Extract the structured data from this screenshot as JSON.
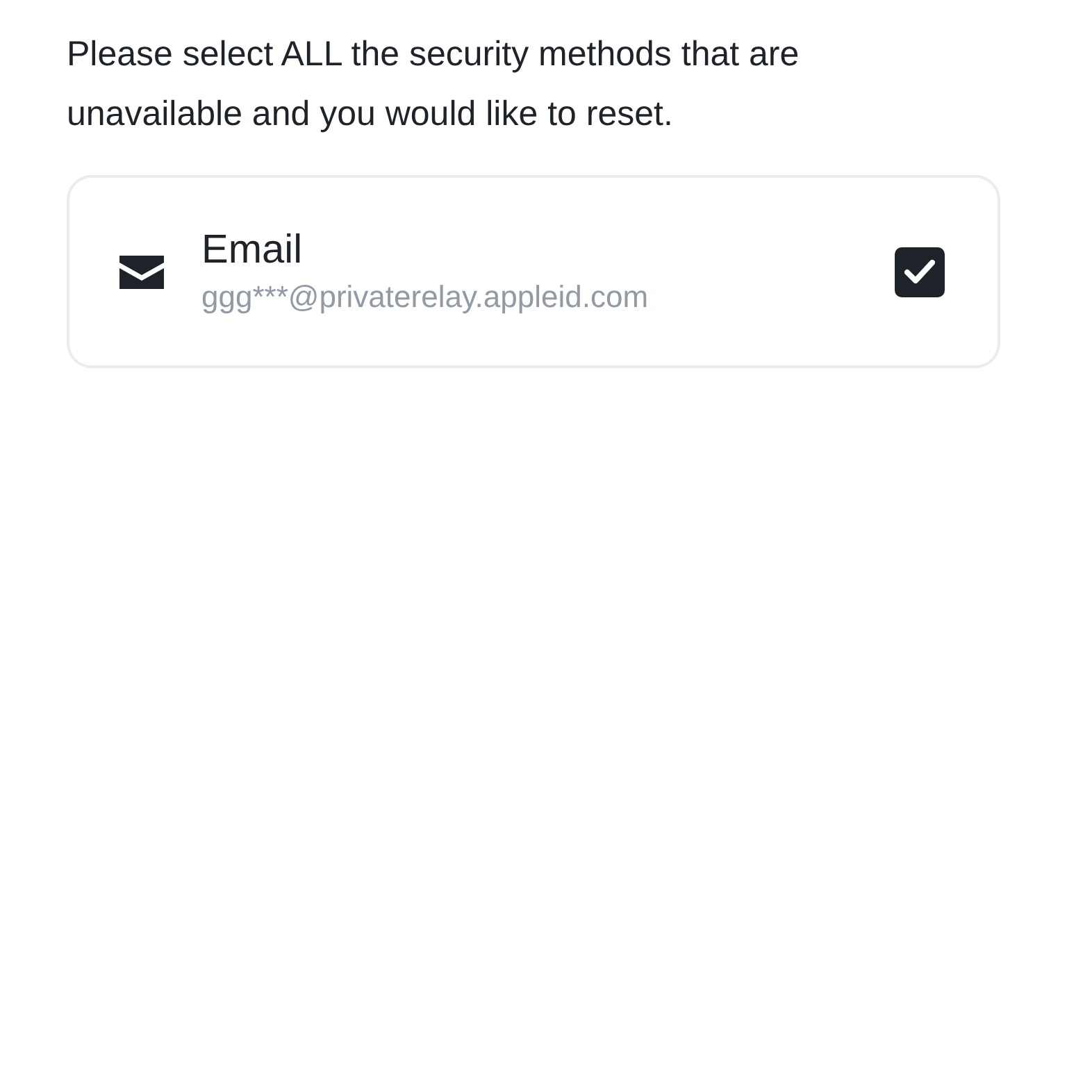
{
  "instructions": "Please select ALL the security methods that are unavailable and you would like to reset.",
  "methods": [
    {
      "kind": "email",
      "title": "Email",
      "detail": "ggg***@privaterelay.appleid.com",
      "checked": true
    }
  ]
}
